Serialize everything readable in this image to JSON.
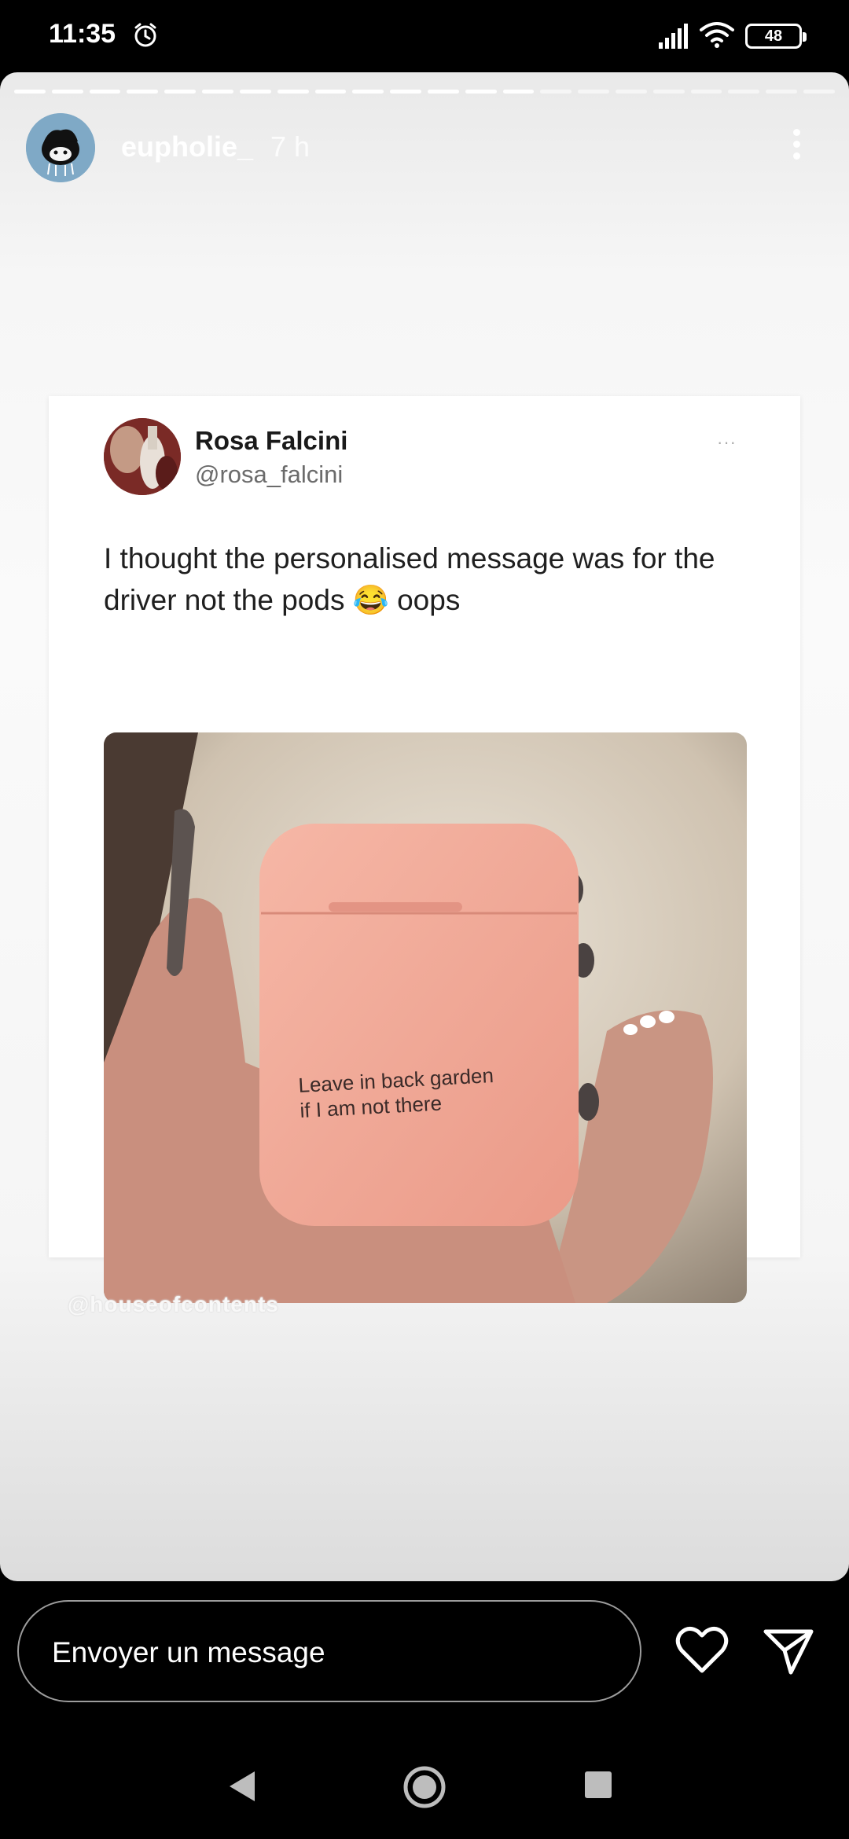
{
  "status_bar": {
    "time": "11:35",
    "battery": "48",
    "icons": [
      "alarm-icon",
      "signal-icon",
      "wifi-icon",
      "battery-icon"
    ]
  },
  "story": {
    "username": "eupholie_",
    "time_ago": "7 h",
    "progress": {
      "segments_total": 22,
      "segments_viewed": 14
    },
    "watermark": "@houseofcontents"
  },
  "tweet": {
    "name": "Rosa Falcini",
    "handle": "@rosa_falcini",
    "more": "···",
    "text": "I thought the personalised message was for the driver not the pods 😂 oops",
    "photo_case_text_line1": "Leave in back garden",
    "photo_case_text_line2": "if I am not there"
  },
  "reply": {
    "placeholder": "Envoyer un message",
    "icons": [
      "heart-icon",
      "send-icon"
    ]
  },
  "nav": {
    "icons": [
      "back-icon",
      "home-icon",
      "recents-icon"
    ]
  },
  "colors": {
    "story_bg": "#f5f5f5",
    "card_bg": "#ffffff",
    "case_pink": "#f2a897"
  }
}
